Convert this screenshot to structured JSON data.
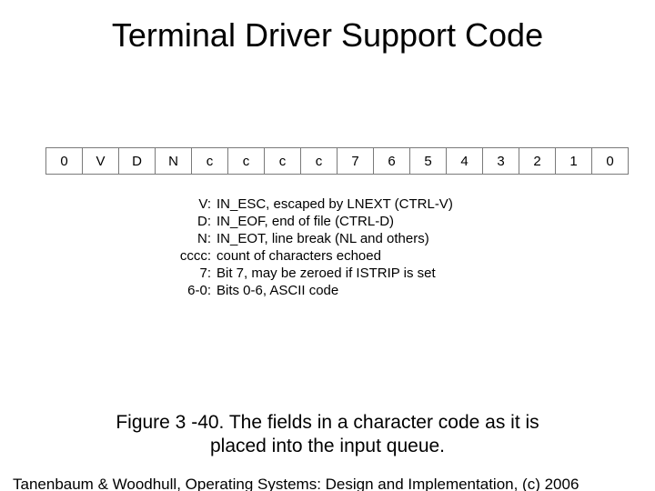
{
  "title": "Terminal Driver Support Code",
  "bitfield": [
    "0",
    "V",
    "D",
    "N",
    "c",
    "c",
    "c",
    "c",
    "7",
    "6",
    "5",
    "4",
    "3",
    "2",
    "1",
    "0"
  ],
  "legend": [
    {
      "key": "V:",
      "desc": "IN_ESC, escaped by LNEXT (CTRL-V)"
    },
    {
      "key": "D:",
      "desc": "IN_EOF, end of file (CTRL-D)"
    },
    {
      "key": "N:",
      "desc": "IN_EOT, line break (NL and others)"
    },
    {
      "key": "cccc:",
      "desc": "count of characters echoed"
    },
    {
      "key": "7:",
      "desc": "Bit 7, may be zeroed if ISTRIP is set"
    },
    {
      "key": "6-0:",
      "desc": "Bits 0-6, ASCII code"
    }
  ],
  "caption_line1": "Figure 3 -40. The fields in a character code as it is",
  "caption_line2": "placed into the input queue.",
  "footer": "Tanenbaum & Woodhull, Operating Systems: Design and Implementation, (c) 2006"
}
